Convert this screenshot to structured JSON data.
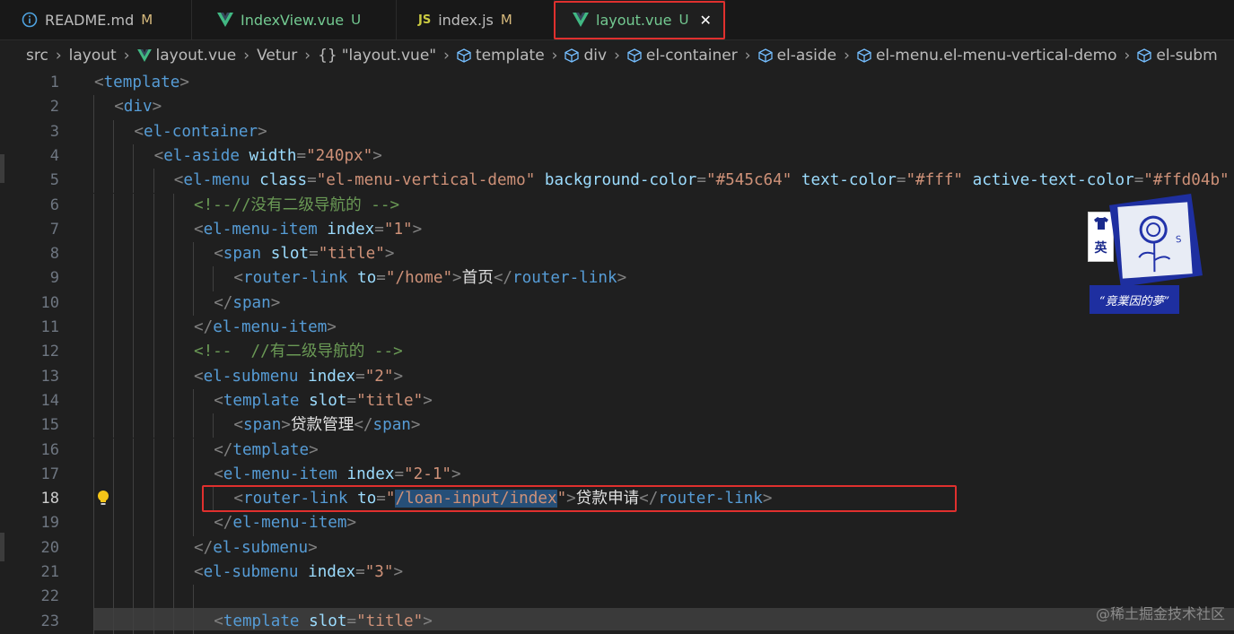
{
  "tabs": [
    {
      "label": "README.md",
      "status": "M",
      "icon": "info-icon"
    },
    {
      "label": "IndexView.vue",
      "status": "U",
      "icon": "vue-icon"
    },
    {
      "label": "index.js",
      "status": "M",
      "icon": "js-icon",
      "icon_text": "JS"
    },
    {
      "label": "layout.vue",
      "status": "U",
      "icon": "vue-icon",
      "active": true,
      "close_glyph": "✕"
    }
  ],
  "breadcrumb": [
    {
      "label": "src"
    },
    {
      "label": "layout"
    },
    {
      "label": "layout.vue",
      "icon": "vue-icon"
    },
    {
      "label": "Vetur"
    },
    {
      "label": "\"layout.vue\"",
      "icon_text": "{}"
    },
    {
      "label": "template",
      "icon": "cube-icon"
    },
    {
      "label": "div",
      "icon": "cube-icon"
    },
    {
      "label": "el-container",
      "icon": "cube-icon"
    },
    {
      "label": "el-aside",
      "icon": "cube-icon"
    },
    {
      "label": "el-menu.el-menu-vertical-demo",
      "icon": "cube-icon"
    },
    {
      "label": "el-subm",
      "icon": "cube-icon"
    }
  ],
  "editor": {
    "current_line": 18,
    "lines": [
      {
        "n": "1",
        "indent": 0,
        "tokens": [
          [
            "p",
            "<"
          ],
          [
            "t",
            "template"
          ],
          [
            "p",
            ">"
          ]
        ]
      },
      {
        "n": "2",
        "indent": 1,
        "tokens": [
          [
            "p",
            "<"
          ],
          [
            "t",
            "div"
          ],
          [
            "p",
            ">"
          ]
        ]
      },
      {
        "n": "3",
        "indent": 2,
        "tokens": [
          [
            "p",
            "<"
          ],
          [
            "t",
            "el-container"
          ],
          [
            "p",
            ">"
          ]
        ]
      },
      {
        "n": "4",
        "indent": 3,
        "tokens": [
          [
            "p",
            "<"
          ],
          [
            "t",
            "el-aside"
          ],
          [
            "a",
            " width"
          ],
          [
            "p",
            "="
          ],
          [
            "s",
            "\"240px\""
          ],
          [
            "p",
            ">"
          ]
        ]
      },
      {
        "n": "5",
        "indent": 4,
        "tokens": [
          [
            "p",
            "<"
          ],
          [
            "t",
            "el-menu"
          ],
          [
            "a",
            " class"
          ],
          [
            "p",
            "="
          ],
          [
            "s",
            "\"el-menu-vertical-demo\""
          ],
          [
            "a",
            " background-color"
          ],
          [
            "p",
            "="
          ],
          [
            "s",
            "\"#545c64\""
          ],
          [
            "a",
            " text-color"
          ],
          [
            "p",
            "="
          ],
          [
            "s",
            "\"#fff\""
          ],
          [
            "a",
            " active-text-color"
          ],
          [
            "p",
            "="
          ],
          [
            "s",
            "\"#ffd04b\""
          ]
        ]
      },
      {
        "n": "6",
        "indent": 5,
        "tokens": [
          [
            "c",
            "<!--//没有二级导航的 -->"
          ]
        ]
      },
      {
        "n": "7",
        "indent": 5,
        "tokens": [
          [
            "p",
            "<"
          ],
          [
            "t",
            "el-menu-item"
          ],
          [
            "a",
            " index"
          ],
          [
            "p",
            "="
          ],
          [
            "s",
            "\"1\""
          ],
          [
            "p",
            ">"
          ]
        ]
      },
      {
        "n": "8",
        "indent": 6,
        "tokens": [
          [
            "p",
            "<"
          ],
          [
            "t",
            "span"
          ],
          [
            "a",
            " slot"
          ],
          [
            "p",
            "="
          ],
          [
            "s",
            "\"title\""
          ],
          [
            "p",
            ">"
          ]
        ]
      },
      {
        "n": "9",
        "indent": 7,
        "tokens": [
          [
            "p",
            "<"
          ],
          [
            "t",
            "router-link"
          ],
          [
            "a",
            " to"
          ],
          [
            "p",
            "="
          ],
          [
            "s",
            "\"/home\""
          ],
          [
            "p",
            ">"
          ],
          [
            "tx",
            "首页"
          ],
          [
            "p",
            "</"
          ],
          [
            "t",
            "router-link"
          ],
          [
            "p",
            ">"
          ]
        ]
      },
      {
        "n": "10",
        "indent": 6,
        "tokens": [
          [
            "p",
            "</"
          ],
          [
            "t",
            "span"
          ],
          [
            "p",
            ">"
          ]
        ]
      },
      {
        "n": "11",
        "indent": 5,
        "tokens": [
          [
            "p",
            "</"
          ],
          [
            "t",
            "el-menu-item"
          ],
          [
            "p",
            ">"
          ]
        ]
      },
      {
        "n": "12",
        "indent": 5,
        "tokens": [
          [
            "c",
            "<!--  //有二级导航的 -->"
          ]
        ]
      },
      {
        "n": "13",
        "indent": 5,
        "tokens": [
          [
            "p",
            "<"
          ],
          [
            "t",
            "el-submenu"
          ],
          [
            "a",
            " index"
          ],
          [
            "p",
            "="
          ],
          [
            "s",
            "\"2\""
          ],
          [
            "p",
            ">"
          ]
        ]
      },
      {
        "n": "14",
        "indent": 6,
        "tokens": [
          [
            "p",
            "<"
          ],
          [
            "t",
            "template"
          ],
          [
            "a",
            " slot"
          ],
          [
            "p",
            "="
          ],
          [
            "s",
            "\"title\""
          ],
          [
            "p",
            ">"
          ]
        ]
      },
      {
        "n": "15",
        "indent": 7,
        "tokens": [
          [
            "p",
            "<"
          ],
          [
            "t",
            "span"
          ],
          [
            "p",
            ">"
          ],
          [
            "tx",
            "贷款管理"
          ],
          [
            "p",
            "</"
          ],
          [
            "t",
            "span"
          ],
          [
            "p",
            ">"
          ]
        ]
      },
      {
        "n": "16",
        "indent": 6,
        "tokens": [
          [
            "p",
            "</"
          ],
          [
            "t",
            "template"
          ],
          [
            "p",
            ">"
          ]
        ]
      },
      {
        "n": "17",
        "indent": 6,
        "tokens": [
          [
            "p",
            "<"
          ],
          [
            "t",
            "el-menu-item"
          ],
          [
            "a",
            " index"
          ],
          [
            "p",
            "="
          ],
          [
            "s",
            "\"2-1\""
          ],
          [
            "p",
            ">"
          ]
        ]
      },
      {
        "n": "18",
        "indent": 7,
        "tokens": [
          [
            "p",
            "<"
          ],
          [
            "t",
            "router-link"
          ],
          [
            "a",
            " to"
          ],
          [
            "p",
            "="
          ],
          [
            "s",
            "\""
          ],
          [
            "sel",
            "/loan-input/index"
          ],
          [
            "s",
            "\""
          ],
          [
            "p",
            ">"
          ],
          [
            "tx",
            "贷款申请"
          ],
          [
            "p",
            "</"
          ],
          [
            "t",
            "router-link"
          ],
          [
            "p",
            ">"
          ]
        ]
      },
      {
        "n": "19",
        "indent": 6,
        "tokens": [
          [
            "p",
            "</"
          ],
          [
            "t",
            "el-menu-item"
          ],
          [
            "p",
            ">"
          ]
        ]
      },
      {
        "n": "20",
        "indent": 5,
        "tokens": [
          [
            "p",
            "</"
          ],
          [
            "t",
            "el-submenu"
          ],
          [
            "p",
            ">"
          ]
        ]
      },
      {
        "n": "21",
        "indent": 5,
        "tokens": [
          [
            "p",
            "<"
          ],
          [
            "t",
            "el-submenu"
          ],
          [
            "a",
            " index"
          ],
          [
            "p",
            "="
          ],
          [
            "s",
            "\"3\""
          ],
          [
            "p",
            ">"
          ]
        ]
      },
      {
        "n": "22",
        "indent": 6,
        "tokens": []
      },
      {
        "n": "23",
        "indent": 6,
        "tokens": [
          [
            "p",
            "<"
          ],
          [
            "t",
            "template"
          ],
          [
            "a",
            " slot"
          ],
          [
            "p",
            "="
          ],
          [
            "s",
            "\"title\""
          ],
          [
            "p",
            ">"
          ]
        ]
      }
    ]
  },
  "overlay_badge": {
    "char_top": "英",
    "caption": "“竟業因的夢”"
  },
  "watermark": "@稀土掘金技术社区",
  "colors": {
    "tag": "#569cd6",
    "attr": "#9cdcfe",
    "string": "#ce9178",
    "comment": "#6a9955",
    "vue_green": "#41b883",
    "js_yellow": "#cbcb41",
    "highlight_red": "#e0302e",
    "selection": "#264f78"
  }
}
